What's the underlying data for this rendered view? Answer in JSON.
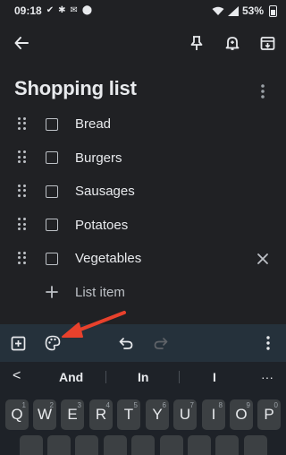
{
  "status_bar": {
    "time": "09:18",
    "battery": "53%",
    "left_icons": [
      "check-icon",
      "bluetooth-icon",
      "gmail-icon",
      "location-icon"
    ],
    "right_icons": [
      "wifi-icon",
      "signal-icon",
      "battery-icon"
    ]
  },
  "top_bar": {
    "back": "back-arrow-icon",
    "actions": [
      "pin-icon",
      "reminder-bell-icon",
      "archive-icon"
    ]
  },
  "note": {
    "title": "Shopping list",
    "items": [
      {
        "label": "Bread",
        "checked": false
      },
      {
        "label": "Burgers",
        "checked": false
      },
      {
        "label": "Sausages",
        "checked": false
      },
      {
        "label": "Potatoes",
        "checked": false
      },
      {
        "label": "Vegetables",
        "checked": false
      }
    ],
    "add_item_label": "List item"
  },
  "editor_toolbar": {
    "left": [
      "add-box-icon",
      "palette-icon"
    ],
    "center": [
      "undo-icon",
      "redo-icon"
    ],
    "right": [
      "more-vert-icon"
    ]
  },
  "keyboard": {
    "suggestions": [
      "And",
      "In",
      "I"
    ],
    "back_glyph": "<",
    "more_glyph": "···",
    "row1": [
      {
        "letter": "Q",
        "digit": "1"
      },
      {
        "letter": "W",
        "digit": "2"
      },
      {
        "letter": "E",
        "digit": "3"
      },
      {
        "letter": "R",
        "digit": "4"
      },
      {
        "letter": "T",
        "digit": "5"
      },
      {
        "letter": "Y",
        "digit": "6"
      },
      {
        "letter": "U",
        "digit": "7"
      },
      {
        "letter": "I",
        "digit": "8"
      },
      {
        "letter": "O",
        "digit": "9"
      },
      {
        "letter": "P",
        "digit": "0"
      }
    ]
  },
  "colors": {
    "background": "#202124",
    "toolbar": "#25313b",
    "keyboard": "#1e2228",
    "key": "#3c4043",
    "annotation_arrow": "#e8412c"
  }
}
